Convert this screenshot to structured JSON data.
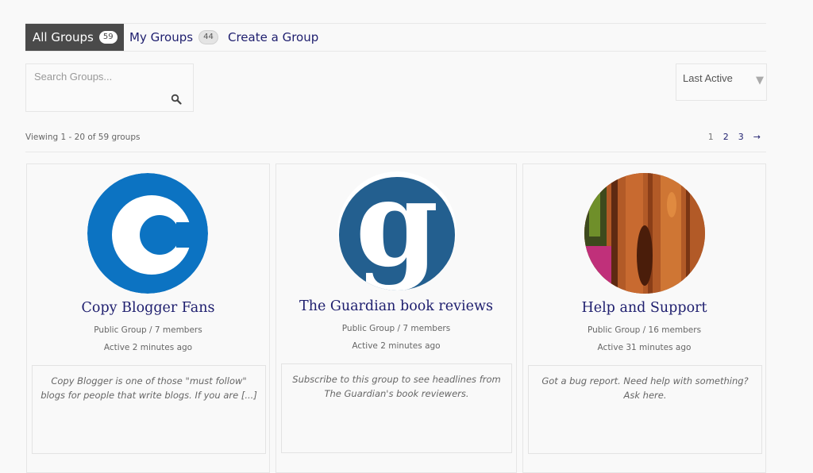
{
  "nav": {
    "tabs": [
      {
        "label": "All Groups",
        "count": "59"
      },
      {
        "label": "My Groups",
        "count": "44"
      },
      {
        "label": "Create a Group"
      }
    ]
  },
  "search": {
    "placeholder": "Search Groups..."
  },
  "sort": {
    "selected": "Last Active"
  },
  "viewing": "Viewing 1 - 20 of 59 groups",
  "pagination": {
    "current": "1",
    "pages": [
      "2",
      "3"
    ],
    "next": "→"
  },
  "groups": [
    {
      "name": "Copy Blogger Fans",
      "type": "Public Group / 7 members",
      "active": "Active 2 minutes ago",
      "description": "Copy Blogger is one of those \"must follow\" blogs for people that write blogs. If you are [...]",
      "avatar_letter": "C",
      "avatar_color": "#0c73c2"
    },
    {
      "name": "The Guardian book reviews",
      "type": "Public Group / 7 members",
      "active": "Active 2 minutes ago",
      "description": "Subscribe to this group to see headlines from The Guardian's book reviewers.",
      "avatar_letter": "g",
      "avatar_color": "#235f8f"
    },
    {
      "name": "Help and Support",
      "type": "Public Group / 16 members",
      "active": "Active 31 minutes ago",
      "description": "Got a bug report. Need help with something? Ask here.",
      "avatar_color": "#a5522a"
    }
  ]
}
